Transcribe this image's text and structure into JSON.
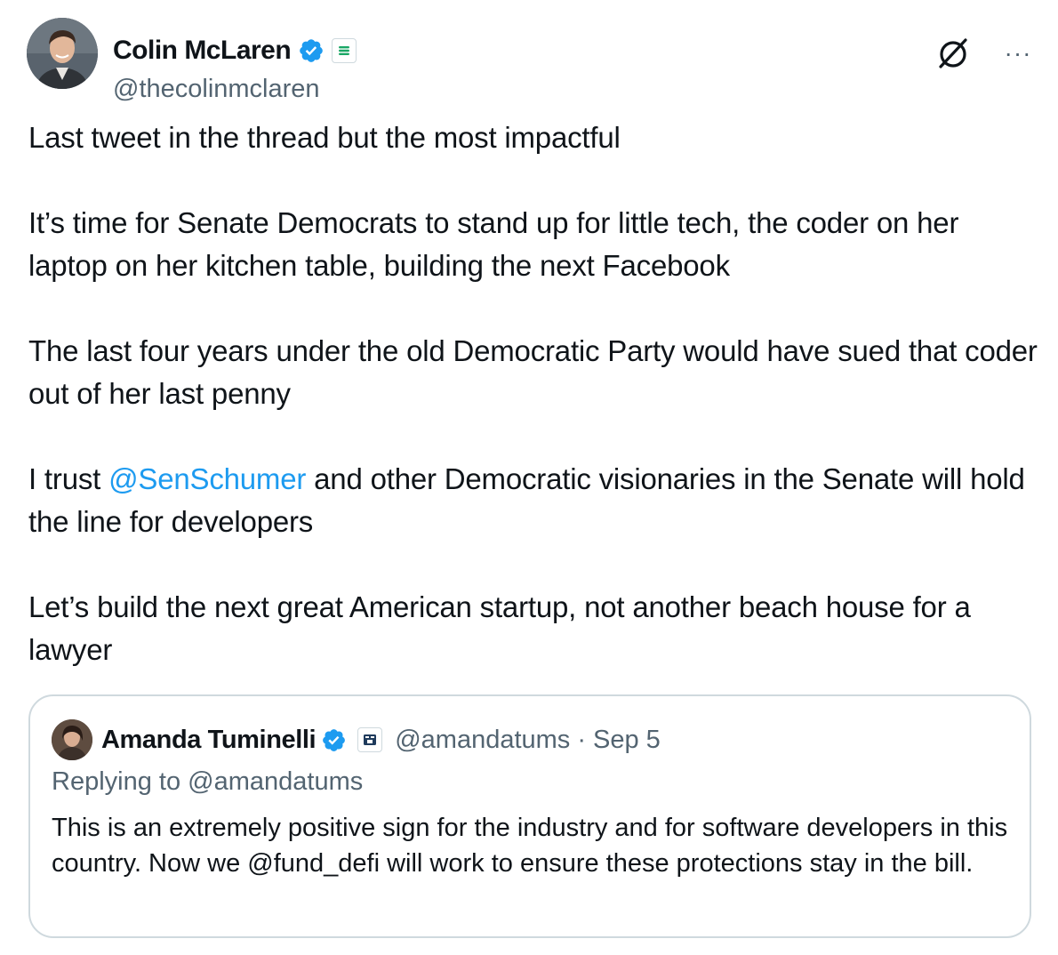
{
  "author": {
    "display_name": "Colin McLaren",
    "handle": "@thecolinmclaren",
    "verified_color": "#1d9bf0",
    "affiliate_badge_color": "#1aa765"
  },
  "tweet": {
    "paragraphs": [
      "Last tweet in the thread but the most impactful",
      "It’s time for Senate Democrats to stand up for little tech, the coder on her laptop on her kitchen table, building the next Facebook",
      "The last four years under the old Democratic Party would have sued that coder out of her last penny",
      "Let’s build the next great American startup, not another beach house for a lawyer"
    ],
    "mention_para": {
      "before": "I trust ",
      "mention": "@SenSchumer",
      "after": " and other Democratic visionaries in the Senate will hold the line for developers"
    }
  },
  "quoted_tweet": {
    "display_name": "Amanda Tuminelli",
    "handle": "@amandatums",
    "separator": "·",
    "date": "Sep 5",
    "replying_to": "Replying to @amandatums",
    "text": "This is an extremely positive sign for the industry and for software developers in this country. Now we @fund_defi will work to ensure these protections stay in the bill."
  },
  "icons": {
    "grok": "grok-icon",
    "more": "more-options-icon",
    "verified": "verified-badge-icon",
    "affiliate": "affiliate-badge-icon"
  },
  "colors": {
    "text_primary": "#0f1419",
    "text_secondary": "#536471",
    "link": "#1d9bf0",
    "border": "#cfd9de"
  }
}
